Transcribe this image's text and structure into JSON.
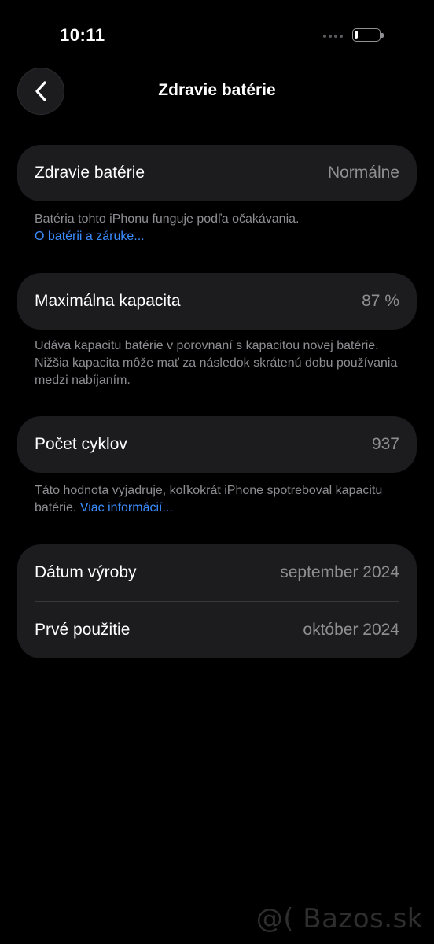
{
  "status_bar": {
    "time": "10:11",
    "battery_level": 0.15
  },
  "header": {
    "title": "Zdravie batérie",
    "back_icon": "chevron-left-icon"
  },
  "health": {
    "label": "Zdravie batérie",
    "value": "Normálne",
    "note": "Batéria tohto iPhonu funguje podľa očakávania.",
    "link": "O batérii a záruke..."
  },
  "capacity": {
    "label": "Maximálna kapacita",
    "value": "87 %",
    "note": "Udáva kapacitu batérie v porovnaní s kapacitou novej batérie. Nižšia kapacita môže mať za následok skrátenú dobu používania medzi nabíjaním."
  },
  "cycles": {
    "label": "Počet cyklov",
    "value": "937",
    "note": "Táto hodnota vyjadruje, koľkokrát iPhone spotreboval kapacitu batérie.",
    "link": "Viac informácií..."
  },
  "dates": {
    "manufacture_label": "Dátum výroby",
    "manufacture_value": "september 2024",
    "first_use_label": "Prvé použitie",
    "first_use_value": "október 2024"
  },
  "watermark": "@( Bazos.sk",
  "colors": {
    "background": "#000000",
    "card": "#1c1c1e",
    "secondary_text": "#8e8e93",
    "link": "#3b8cff"
  }
}
